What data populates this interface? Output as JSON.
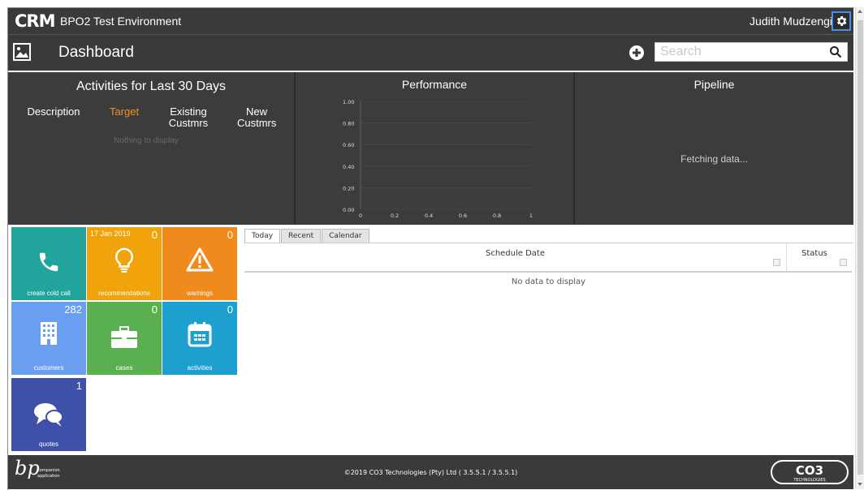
{
  "header": {
    "logo_text": "CRM",
    "env_title": "BPO2 Test Environment",
    "user_name": "Judith Mudzengi",
    "settings_icon": "gear-icon"
  },
  "subbar": {
    "title": "Dashboard",
    "search_placeholder": "Search"
  },
  "activities": {
    "title": "Activities for Last 30 Days",
    "columns": [
      "Description",
      "Target",
      "Existing Custmrs",
      "New Custmrs"
    ],
    "empty_text": "Nothing to display"
  },
  "performance": {
    "title": "Performance",
    "chart_data": {
      "type": "line",
      "title": "Performance",
      "x_ticks": [
        "0",
        "0.2",
        "0.4",
        "0.6",
        "0.8",
        "1"
      ],
      "y_ticks": [
        "1.00",
        "0.80",
        "0.60",
        "0.40",
        "0.20",
        "0.00"
      ],
      "xlim": [
        0,
        1
      ],
      "ylim": [
        0,
        1
      ],
      "grid": true,
      "series": []
    }
  },
  "pipeline": {
    "title": "Pipeline",
    "status_text": "Fetching data..."
  },
  "tiles": [
    {
      "key": "cold-call",
      "label": "create cold call",
      "count": "",
      "date": "",
      "color": "#21a49c",
      "icon": "phone-icon"
    },
    {
      "key": "recommendations",
      "label": "recommendations",
      "count": "0",
      "date": "17 Jan 2019",
      "color": "#f0a30a",
      "icon": "lightbulb-icon"
    },
    {
      "key": "warnings",
      "label": "warnings",
      "count": "0",
      "date": "",
      "color": "#f08a1c",
      "icon": "warning-icon"
    },
    {
      "key": "customers",
      "label": "customers",
      "count": "282",
      "date": "",
      "color": "#6b9ef0",
      "icon": "building-icon"
    },
    {
      "key": "cases",
      "label": "cases",
      "count": "0",
      "date": "",
      "color": "#5ab04e",
      "icon": "briefcase-icon"
    },
    {
      "key": "activities",
      "label": "activities",
      "count": "0",
      "date": "",
      "color": "#1da0d0",
      "icon": "calendar-icon"
    },
    {
      "key": "quotes",
      "label": "quotes",
      "count": "1",
      "date": "",
      "color": "#3f50a8",
      "icon": "chat-bubbles-icon"
    }
  ],
  "schedule": {
    "tabs": [
      "Today",
      "Recent",
      "Calendar"
    ],
    "active_tab": "Today",
    "columns": [
      "Schedule Date",
      "Status"
    ],
    "empty_text": "No data to display"
  },
  "footer": {
    "copyright": "©2019 CO3 Technologies (Pty) Ltd ( 3.5.5.1 / 3.5.5.1)",
    "left_logo_text": "bp",
    "left_logo_sub1": "companion",
    "left_logo_sub2": "application",
    "right_logo_text": "CO3",
    "right_logo_sub": "TECHNOLOGIES"
  }
}
